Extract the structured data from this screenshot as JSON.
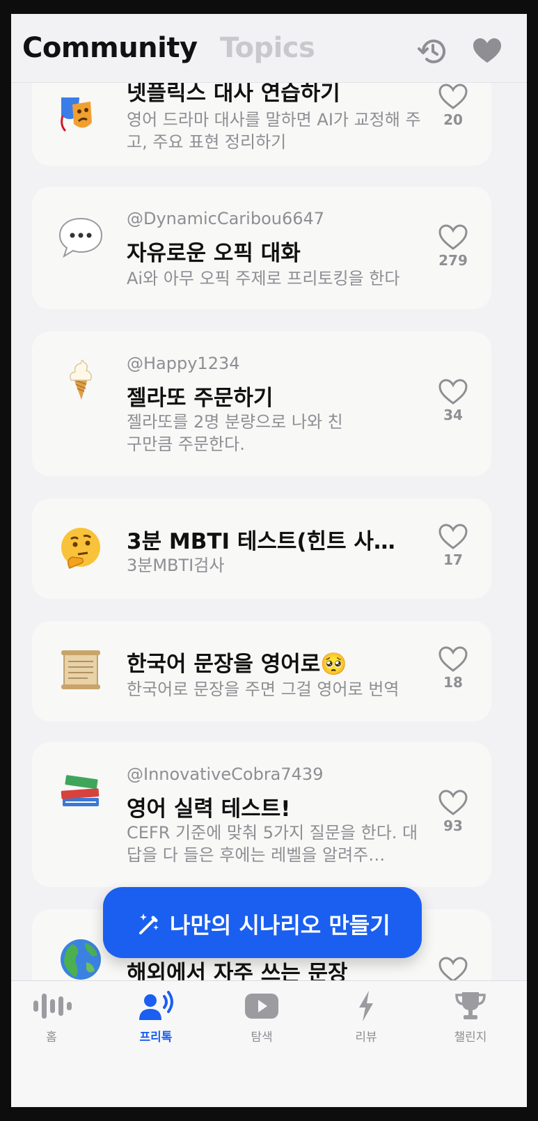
{
  "header": {
    "title": "Community",
    "tab_topics": "Topics",
    "icons": [
      "history-icon",
      "heart-filled-icon"
    ]
  },
  "cards": [
    {
      "emoji": "theater-masks-icon",
      "author": "",
      "title": "넷플릭스 대사 연습하기",
      "description": "영어 드라마 대사를 말하면 AI가 교정해 주고, 주요 표현 정리하기",
      "likes": "20"
    },
    {
      "emoji": "speech-bubble-icon",
      "author": "@DynamicCaribou6647",
      "title": "자유로운 오픽 대화",
      "description": "Ai와 아무 오픽 주제로 프리토킹을 한다",
      "likes": "279"
    },
    {
      "emoji": "soft-ice-cream-icon",
      "author": "@Happy1234",
      "title": "젤라또 주문하기",
      "description": "젤라또를 2명 분량으로 나와 친구만큼 주문한다.",
      "likes": "34"
    },
    {
      "emoji": "thinking-face-icon",
      "author": "",
      "title": "3분 MBTI 테스트(힌트 사…",
      "description": "3분MBTI검사",
      "likes": "17"
    },
    {
      "emoji": "scroll-icon",
      "author": "",
      "title": "한국어 문장을 영어로🥺",
      "description": "한국어로 문장을 주면 그걸 영어로 번역",
      "likes": "18"
    },
    {
      "emoji": "books-icon",
      "author": "@InnovativeCobra7439",
      "title": "영어 실력 테스트!",
      "description": "CEFR 기준에 맞춰 5가지 질문을 한다. 대답을 다 들은 후에는 레벨을 알려주…",
      "likes": "93"
    },
    {
      "emoji": "globe-icon",
      "author": "",
      "title": "해외에서 자주 쓰는 문장",
      "description": "",
      "likes": ""
    }
  ],
  "create_button": {
    "label": "나만의 시나리오 만들기",
    "icon": "magic-wand-icon"
  },
  "tabbar": {
    "items": [
      {
        "label": "홈",
        "icon": "waveform-icon",
        "active": false
      },
      {
        "label": "프리톡",
        "icon": "person-speaking-icon",
        "active": true
      },
      {
        "label": "탐색",
        "icon": "play-video-icon",
        "active": false
      },
      {
        "label": "리뷰",
        "icon": "lightning-bolt-icon",
        "active": false
      },
      {
        "label": "챌린지",
        "icon": "trophy-icon",
        "active": false
      }
    ]
  },
  "colors": {
    "accent": "#1a5ff0",
    "background": "#f2f2f4",
    "card": "#f8f8f7",
    "muted_text": "#8e8e93"
  }
}
